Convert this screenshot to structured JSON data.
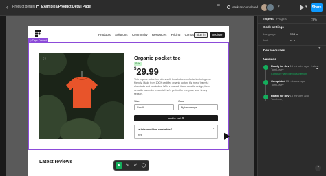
{
  "topbar": {
    "back_label": "‹",
    "breadcrumb_parent": "Product details",
    "separator": "/",
    "breadcrumb_current": "Examples/Product Detail Page",
    "more_label": "•••",
    "mark_complete_label": "Mark as completed",
    "share_label": "Share"
  },
  "site": {
    "nav": [
      "Products",
      "Solutions",
      "Community",
      "Resources",
      "Pricing",
      "Contact"
    ],
    "signin_label": "Sign in",
    "register_label": "Register"
  },
  "selection": {
    "tag_label": "◇ Page Product"
  },
  "product": {
    "title": "Organic pocket tee",
    "badge": "Sale",
    "currency": "$",
    "price": "29.99",
    "description": "This organic cotton tee offers soft, breathable comfort while being eco-friendly. Made from 100% certified organic cotton, it's free of harmful chemicals and pesticides. With a relaxed fit and durable design, it's a versatile wardrobe essential that's perfect for everyday wear in any season.",
    "size_label": "Size",
    "size_value": "Small",
    "color_label": "Color",
    "color_value": "Pylon orange",
    "add_to_cart_label": "Add to cart",
    "faq_question": "Is this machine washable?",
    "faq_answer": "Yes"
  },
  "reviews": {
    "heading": "Latest reviews"
  },
  "right_panel": {
    "tabs": [
      "Inspect",
      "Plugins"
    ],
    "zoom": "78%",
    "code_settings_heading": "Code settings",
    "language_label": "Language",
    "language_value": "CSS",
    "unit_label": "Unit",
    "unit_value": "px",
    "dev_resources_heading": "Dev resources",
    "versions_heading": "Versions",
    "versions": [
      {
        "title": "Ready for dev",
        "time": "15 minutes ago · Latest",
        "author": "Tom Lowry",
        "link": "Compare with previous version"
      },
      {
        "title": "Completed",
        "time": "15 minutes ago",
        "author": "Tom Lowry",
        "link": ""
      },
      {
        "title": "Ready for dev",
        "time": "15 minutes ago",
        "author": "Tom Lowry",
        "link": ""
      }
    ],
    "help_label": "?"
  },
  "colors": {
    "accent": "#0d99ff",
    "selection": "#8c4bd9",
    "ready": "#14ae5c",
    "tee": "#e8542a"
  }
}
